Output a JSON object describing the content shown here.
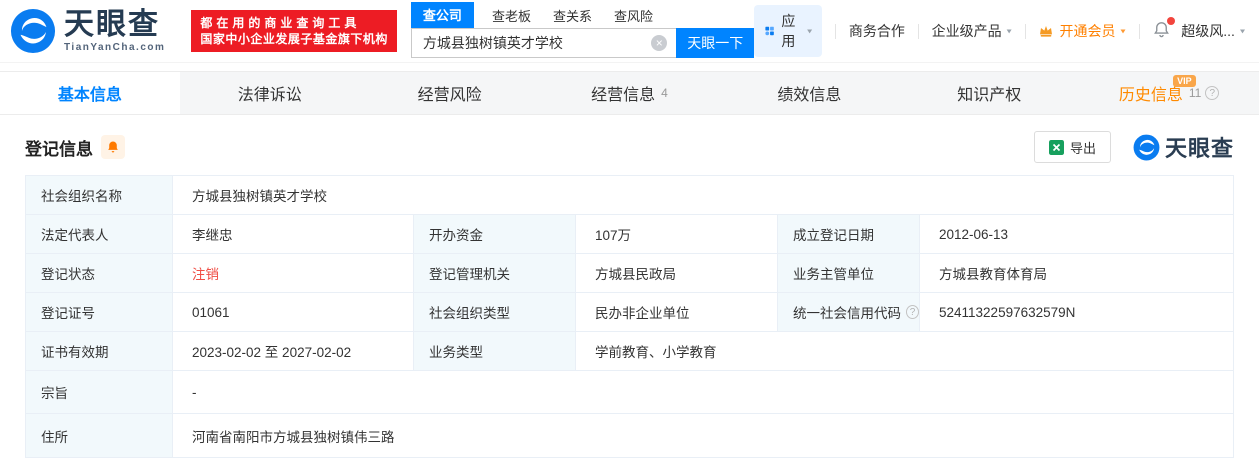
{
  "colors": {
    "accent_blue": "#0084ff",
    "promo_red": "#ed1c24",
    "member_orange": "#ff8000",
    "history_orange": "#ff8a00",
    "status_red": "#f04e45",
    "label_bg": "#f2f9fc",
    "table_border": "#e9eff6"
  },
  "header": {
    "logo": {
      "name": "天眼查",
      "domain": "TianYanCha.com"
    },
    "promo": {
      "line1": "都在用的商业查询工具",
      "line2": "国家中小企业发展子基金旗下机构"
    },
    "search": {
      "tabs": [
        {
          "label": "查公司"
        },
        {
          "label": "查老板"
        },
        {
          "label": "查关系"
        },
        {
          "label": "查风险"
        }
      ],
      "value": "方城县独树镇英才学校",
      "button": "天眼一下"
    },
    "nav": {
      "apps": "应用",
      "cooperation": "商务合作",
      "enterprise": "企业级产品",
      "member": "开通会员",
      "user": "超级风..."
    }
  },
  "tabs": [
    {
      "label": "基本信息"
    },
    {
      "label": "法律诉讼"
    },
    {
      "label": "经营风险"
    },
    {
      "label": "经营信息",
      "count": "4"
    },
    {
      "label": "绩效信息"
    },
    {
      "label": "知识产权"
    },
    {
      "label": "历史信息",
      "count": "11",
      "badge": "VIP"
    }
  ],
  "section": {
    "title": "登记信息",
    "export": "导出",
    "watermark": "天眼查"
  },
  "icons": {
    "clear": "×",
    "help": "?",
    "caret": "▾"
  },
  "table": {
    "rows": [
      {
        "cells": [
          {
            "label": "社会组织名称",
            "value": "方城县独树镇英才学校"
          }
        ]
      },
      {
        "cells": [
          {
            "label": "法定代表人",
            "value": "李继忠"
          },
          {
            "label": "开办资金",
            "value": "107万"
          },
          {
            "label": "成立登记日期",
            "value": "2012-06-13"
          }
        ]
      },
      {
        "cells": [
          {
            "label": "登记状态",
            "value": "注销"
          },
          {
            "label": "登记管理机关",
            "value": "方城县民政局"
          },
          {
            "label": "业务主管单位",
            "value": "方城县教育体育局"
          }
        ]
      },
      {
        "cells": [
          {
            "label": "登记证号",
            "value": "01061"
          },
          {
            "label": "社会组织类型",
            "value": "民办非企业单位"
          },
          {
            "label": "统一社会信用代码",
            "value": "52411322597632579N"
          }
        ]
      },
      {
        "cells": [
          {
            "label": "证书有效期",
            "value": "2023-02-02 至 2027-02-02"
          },
          {
            "label": "业务类型",
            "value": "学前教育、小学教育"
          }
        ]
      },
      {
        "cells": [
          {
            "label": "宗旨",
            "value": "-"
          }
        ]
      },
      {
        "cells": [
          {
            "label": "住所",
            "value": "河南省南阳市方城县独树镇伟三路"
          }
        ]
      }
    ]
  }
}
